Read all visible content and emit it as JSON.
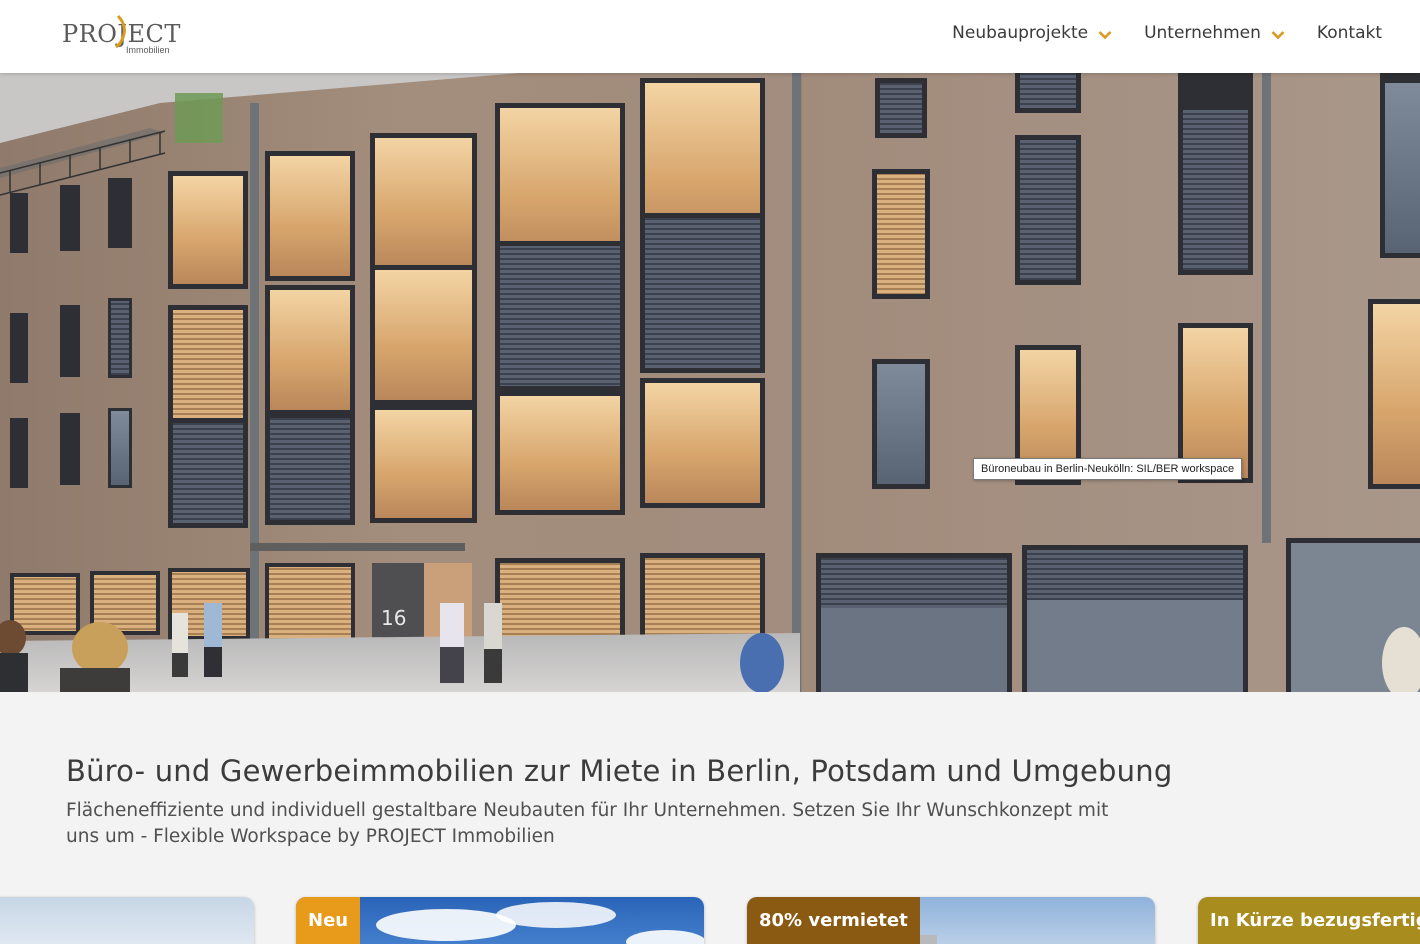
{
  "header": {
    "logo": {
      "word": "PROJECT",
      "sub": "Immobilien"
    },
    "nav": [
      {
        "label": "Neubauprojekte",
        "has_dropdown": true
      },
      {
        "label": "Unternehmen",
        "has_dropdown": true
      },
      {
        "label": "Kontakt",
        "has_dropdown": false
      }
    ]
  },
  "hero": {
    "entrance_number": "16",
    "tooltip": "Büroneubau in Berlin-Neukölln: SIL/BER workspace"
  },
  "intro": {
    "title": "Büro- und Gewerbeimmobilien zur Miete in Berlin, Potsdam und Umgebung",
    "text": "Flächeneffiziente und individuell gestaltbare Neubauten für Ihr Unternehmen. Setzen Sie Ihr Wunschkonzept mit uns um - Flexible Workspace by PROJECT Immobilien"
  },
  "cards": [
    {
      "badge": ""
    },
    {
      "badge": "Neu"
    },
    {
      "badge": "80% vermietet"
    },
    {
      "badge": "In Kürze bezugsfertig"
    }
  ],
  "colors": {
    "accent": "#d99a1e",
    "badge_neu": "#e89a1b",
    "badge_vermietet": "#8a5a12",
    "badge_bezugsfertig": "#a88c1d",
    "facade": "#a38d7c"
  },
  "icons": {
    "dropdown": "chevron-down-icon"
  }
}
